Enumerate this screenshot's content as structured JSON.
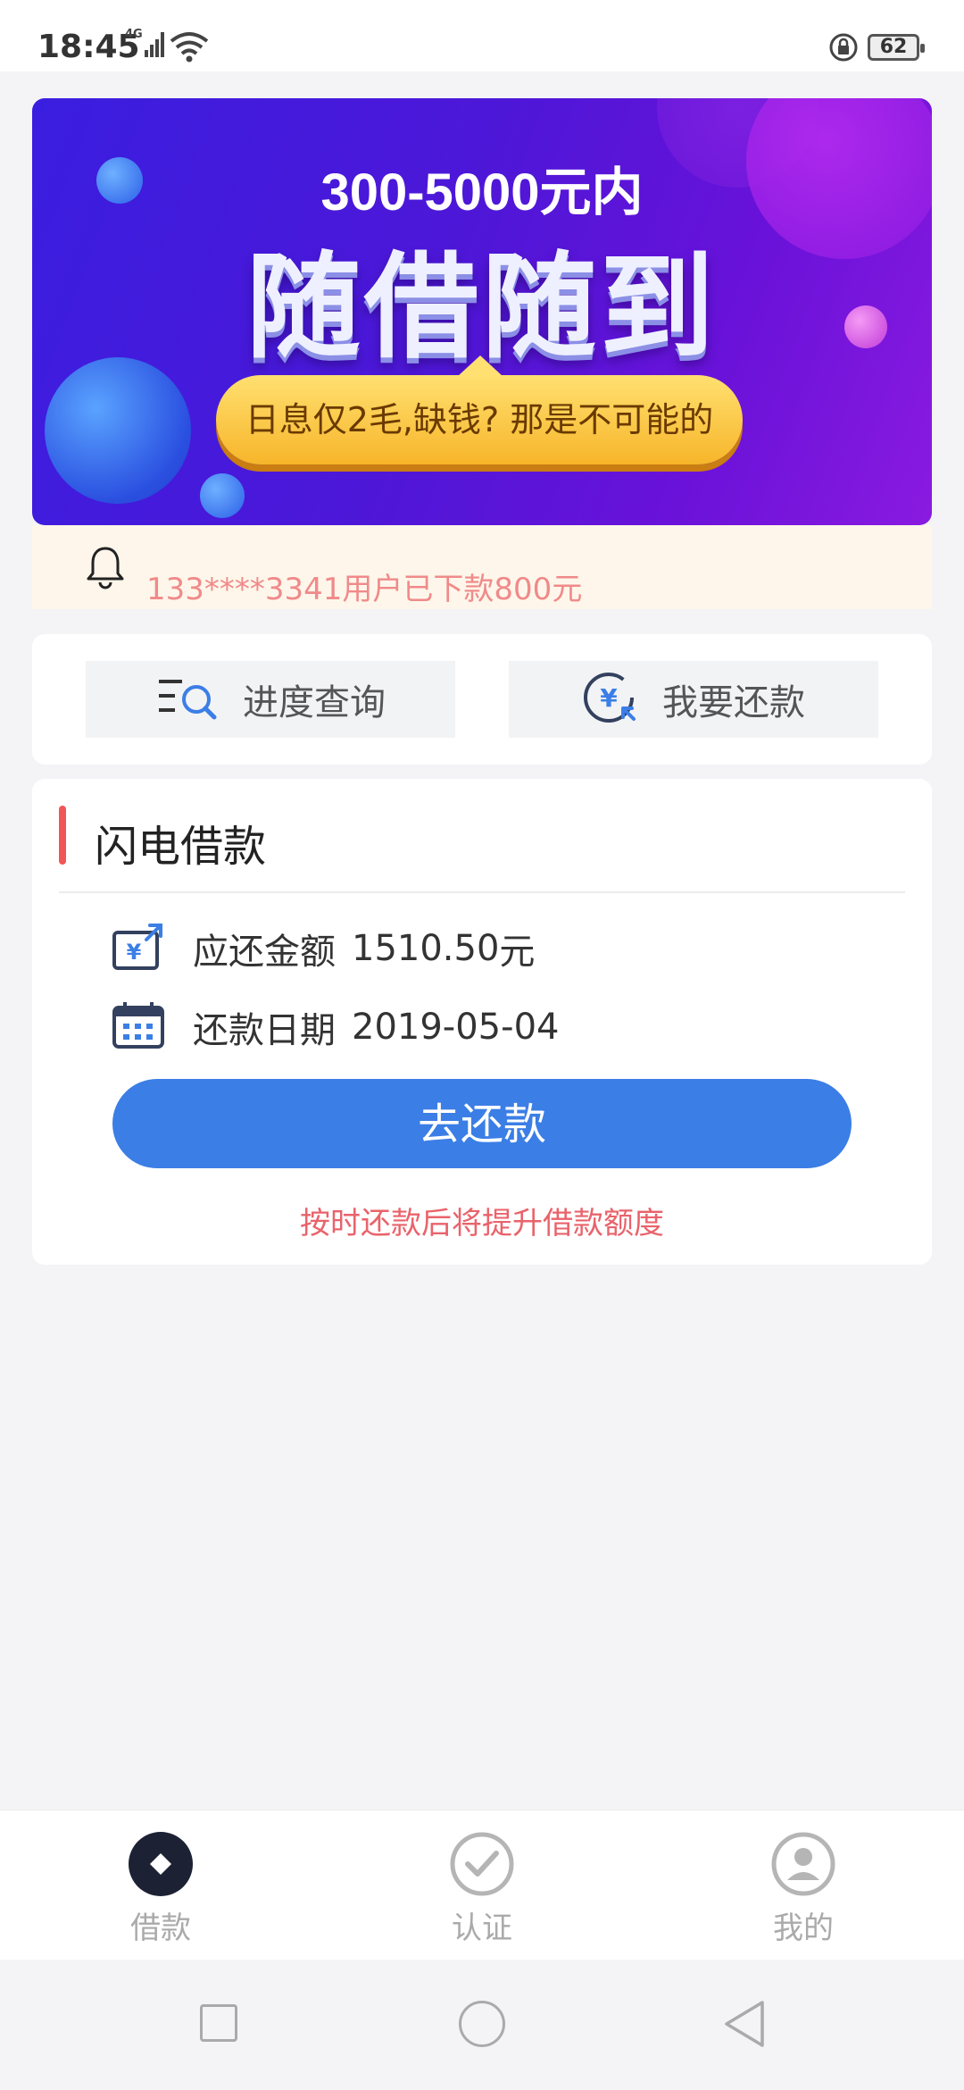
{
  "status_bar": {
    "time": "18:45",
    "network": "4G",
    "battery": "62"
  },
  "banner": {
    "subtitle": "300-5000元内",
    "headline": "随借随到",
    "pill_text": "日息仅2毛,缺钱? 那是不可能的"
  },
  "notice": {
    "text": "133****3341用户已下款800元"
  },
  "actions": {
    "progress_label": "进度查询",
    "repay_label": "我要还款"
  },
  "loan": {
    "title": "闪电借款",
    "amount_label": "应还金额",
    "amount_value": "1510.50",
    "amount_unit": "元",
    "date_label": "还款日期",
    "date_value": "2019-05-04",
    "button_label": "去还款",
    "hint": "按时还款后将提升借款额度"
  },
  "tabbar": {
    "items": [
      {
        "label": "借款"
      },
      {
        "label": "认证"
      },
      {
        "label": "我的"
      }
    ]
  },
  "colors": {
    "primary": "#3b7ee6",
    "accent_red": "#f15656",
    "hint_red": "#e9636b",
    "notice_text": "#f08a8a",
    "banner_purple": "#4d17d8"
  },
  "icons": {
    "bell": "bell-icon",
    "progress": "list-search-icon",
    "repay": "yuan-arrow-icon",
    "amount": "yuan-share-icon",
    "date": "calendar-icon",
    "tab_loan": "diamond-icon",
    "tab_auth": "check-circle-icon",
    "tab_mine": "user-icon"
  }
}
